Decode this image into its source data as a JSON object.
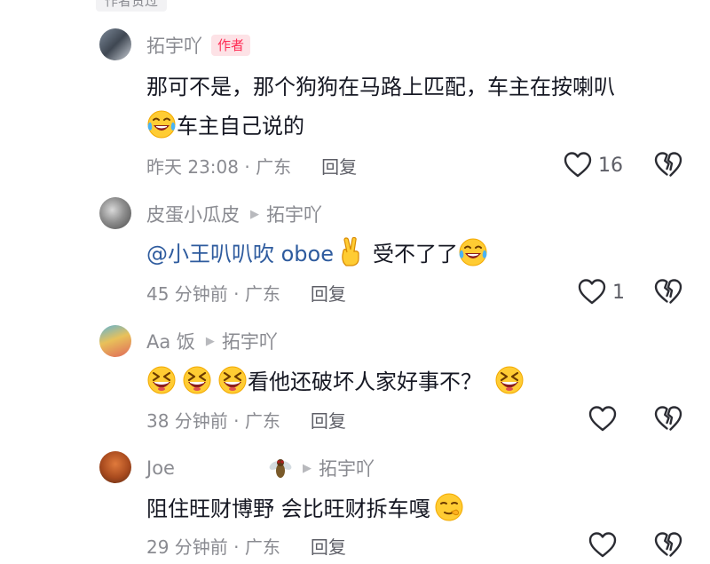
{
  "top_tag": "作者赞过",
  "comments": [
    {
      "username": "拓宇吖",
      "badge": "作者",
      "text1": "那可不是，那个狗狗在马路上匹配，车主在按喇叭",
      "text2": "车主自己说的",
      "time_location": "昨天 23:08 · 广东",
      "reply_label": "回复",
      "likes": "16"
    },
    {
      "username": "皮蛋小瓜皮",
      "reply_to": "拓宇吖",
      "mention": "@小王叭叭吹 oboe",
      "text": "受不了了",
      "time_location": "45 分钟前 · 广东",
      "reply_label": "回复",
      "likes": "1"
    },
    {
      "username": "Aa 饭",
      "reply_to": "拓宇吖",
      "text": "看他还破坏人家好事不？",
      "time_location": "38 分钟前 · 广东",
      "reply_label": "回复"
    },
    {
      "username": "Joe",
      "reply_to": "拓宇吖",
      "text": "阻住旺财博野 会比旺财拆车嘎",
      "time_location": "29 分钟前 · 广东",
      "reply_label": "回复"
    }
  ],
  "icons": {
    "like": "heart-outline-icon",
    "dislike": "broken-heart-icon",
    "emoji_laugh_cry": "laugh-cry-emoji-icon",
    "emoji_grin": "grin-squint-emoji-icon",
    "emoji_victory": "victory-hand-emoji-icon",
    "emoji_smirk": "smirk-emoji-icon",
    "fly": "fly-icon"
  },
  "colors": {
    "accent": "#fe2c55",
    "mention": "#2e5b9e",
    "muted": "#8a8b91"
  }
}
